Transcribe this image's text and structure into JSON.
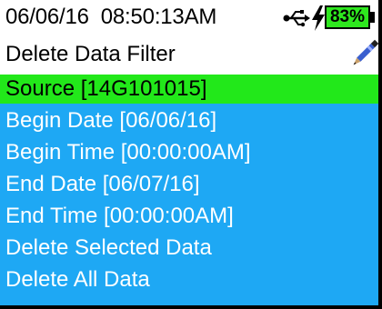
{
  "status_bar": {
    "datetime": "06/06/16  08:50:13AM",
    "battery_percent": "83%",
    "icons": [
      "usb-icon",
      "charging-bolt-icon",
      "battery-icon"
    ]
  },
  "title": {
    "text": "Delete Data Filter",
    "icon": "pen-icon"
  },
  "menu": {
    "items": [
      {
        "label": "Source [14G101015]",
        "selected": true
      },
      {
        "label": "Begin Date [06/06/16]",
        "selected": false
      },
      {
        "label": "Begin Time [00:00:00AM]",
        "selected": false
      },
      {
        "label": "End Date [06/07/16]",
        "selected": false
      },
      {
        "label": "End Time [00:00:00AM]",
        "selected": false
      },
      {
        "label": "Delete Selected Data",
        "selected": false
      },
      {
        "label": "Delete All Data",
        "selected": false
      }
    ]
  },
  "colors": {
    "menu_background": "#1ea8f4",
    "selected_background": "#22e81a",
    "battery_fill": "#2ee81e"
  }
}
